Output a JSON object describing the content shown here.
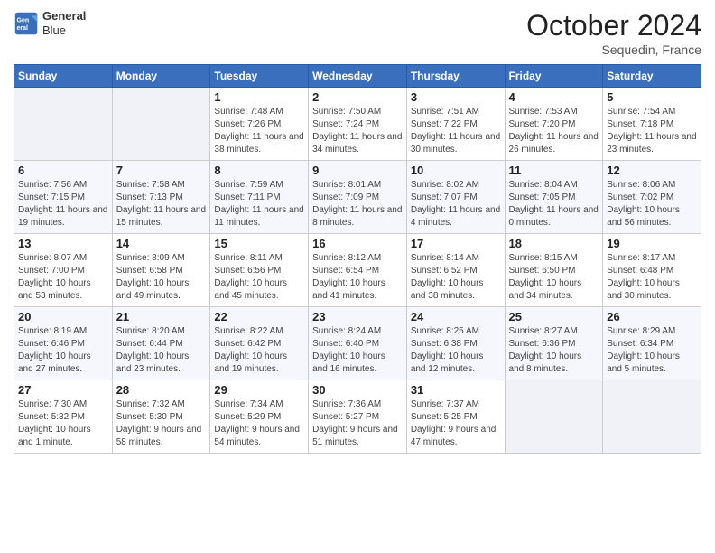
{
  "logo": {
    "line1": "General",
    "line2": "Blue"
  },
  "header": {
    "month": "October 2024",
    "location": "Sequedin, France"
  },
  "weekdays": [
    "Sunday",
    "Monday",
    "Tuesday",
    "Wednesday",
    "Thursday",
    "Friday",
    "Saturday"
  ],
  "weeks": [
    [
      {
        "day": "",
        "sunrise": "",
        "sunset": "",
        "daylight": ""
      },
      {
        "day": "",
        "sunrise": "",
        "sunset": "",
        "daylight": ""
      },
      {
        "day": "1",
        "sunrise": "Sunrise: 7:48 AM",
        "sunset": "Sunset: 7:26 PM",
        "daylight": "Daylight: 11 hours and 38 minutes."
      },
      {
        "day": "2",
        "sunrise": "Sunrise: 7:50 AM",
        "sunset": "Sunset: 7:24 PM",
        "daylight": "Daylight: 11 hours and 34 minutes."
      },
      {
        "day": "3",
        "sunrise": "Sunrise: 7:51 AM",
        "sunset": "Sunset: 7:22 PM",
        "daylight": "Daylight: 11 hours and 30 minutes."
      },
      {
        "day": "4",
        "sunrise": "Sunrise: 7:53 AM",
        "sunset": "Sunset: 7:20 PM",
        "daylight": "Daylight: 11 hours and 26 minutes."
      },
      {
        "day": "5",
        "sunrise": "Sunrise: 7:54 AM",
        "sunset": "Sunset: 7:18 PM",
        "daylight": "Daylight: 11 hours and 23 minutes."
      }
    ],
    [
      {
        "day": "6",
        "sunrise": "Sunrise: 7:56 AM",
        "sunset": "Sunset: 7:15 PM",
        "daylight": "Daylight: 11 hours and 19 minutes."
      },
      {
        "day": "7",
        "sunrise": "Sunrise: 7:58 AM",
        "sunset": "Sunset: 7:13 PM",
        "daylight": "Daylight: 11 hours and 15 minutes."
      },
      {
        "day": "8",
        "sunrise": "Sunrise: 7:59 AM",
        "sunset": "Sunset: 7:11 PM",
        "daylight": "Daylight: 11 hours and 11 minutes."
      },
      {
        "day": "9",
        "sunrise": "Sunrise: 8:01 AM",
        "sunset": "Sunset: 7:09 PM",
        "daylight": "Daylight: 11 hours and 8 minutes."
      },
      {
        "day": "10",
        "sunrise": "Sunrise: 8:02 AM",
        "sunset": "Sunset: 7:07 PM",
        "daylight": "Daylight: 11 hours and 4 minutes."
      },
      {
        "day": "11",
        "sunrise": "Sunrise: 8:04 AM",
        "sunset": "Sunset: 7:05 PM",
        "daylight": "Daylight: 11 hours and 0 minutes."
      },
      {
        "day": "12",
        "sunrise": "Sunrise: 8:06 AM",
        "sunset": "Sunset: 7:02 PM",
        "daylight": "Daylight: 10 hours and 56 minutes."
      }
    ],
    [
      {
        "day": "13",
        "sunrise": "Sunrise: 8:07 AM",
        "sunset": "Sunset: 7:00 PM",
        "daylight": "Daylight: 10 hours and 53 minutes."
      },
      {
        "day": "14",
        "sunrise": "Sunrise: 8:09 AM",
        "sunset": "Sunset: 6:58 PM",
        "daylight": "Daylight: 10 hours and 49 minutes."
      },
      {
        "day": "15",
        "sunrise": "Sunrise: 8:11 AM",
        "sunset": "Sunset: 6:56 PM",
        "daylight": "Daylight: 10 hours and 45 minutes."
      },
      {
        "day": "16",
        "sunrise": "Sunrise: 8:12 AM",
        "sunset": "Sunset: 6:54 PM",
        "daylight": "Daylight: 10 hours and 41 minutes."
      },
      {
        "day": "17",
        "sunrise": "Sunrise: 8:14 AM",
        "sunset": "Sunset: 6:52 PM",
        "daylight": "Daylight: 10 hours and 38 minutes."
      },
      {
        "day": "18",
        "sunrise": "Sunrise: 8:15 AM",
        "sunset": "Sunset: 6:50 PM",
        "daylight": "Daylight: 10 hours and 34 minutes."
      },
      {
        "day": "19",
        "sunrise": "Sunrise: 8:17 AM",
        "sunset": "Sunset: 6:48 PM",
        "daylight": "Daylight: 10 hours and 30 minutes."
      }
    ],
    [
      {
        "day": "20",
        "sunrise": "Sunrise: 8:19 AM",
        "sunset": "Sunset: 6:46 PM",
        "daylight": "Daylight: 10 hours and 27 minutes."
      },
      {
        "day": "21",
        "sunrise": "Sunrise: 8:20 AM",
        "sunset": "Sunset: 6:44 PM",
        "daylight": "Daylight: 10 hours and 23 minutes."
      },
      {
        "day": "22",
        "sunrise": "Sunrise: 8:22 AM",
        "sunset": "Sunset: 6:42 PM",
        "daylight": "Daylight: 10 hours and 19 minutes."
      },
      {
        "day": "23",
        "sunrise": "Sunrise: 8:24 AM",
        "sunset": "Sunset: 6:40 PM",
        "daylight": "Daylight: 10 hours and 16 minutes."
      },
      {
        "day": "24",
        "sunrise": "Sunrise: 8:25 AM",
        "sunset": "Sunset: 6:38 PM",
        "daylight": "Daylight: 10 hours and 12 minutes."
      },
      {
        "day": "25",
        "sunrise": "Sunrise: 8:27 AM",
        "sunset": "Sunset: 6:36 PM",
        "daylight": "Daylight: 10 hours and 8 minutes."
      },
      {
        "day": "26",
        "sunrise": "Sunrise: 8:29 AM",
        "sunset": "Sunset: 6:34 PM",
        "daylight": "Daylight: 10 hours and 5 minutes."
      }
    ],
    [
      {
        "day": "27",
        "sunrise": "Sunrise: 7:30 AM",
        "sunset": "Sunset: 5:32 PM",
        "daylight": "Daylight: 10 hours and 1 minute."
      },
      {
        "day": "28",
        "sunrise": "Sunrise: 7:32 AM",
        "sunset": "Sunset: 5:30 PM",
        "daylight": "Daylight: 9 hours and 58 minutes."
      },
      {
        "day": "29",
        "sunrise": "Sunrise: 7:34 AM",
        "sunset": "Sunset: 5:29 PM",
        "daylight": "Daylight: 9 hours and 54 minutes."
      },
      {
        "day": "30",
        "sunrise": "Sunrise: 7:36 AM",
        "sunset": "Sunset: 5:27 PM",
        "daylight": "Daylight: 9 hours and 51 minutes."
      },
      {
        "day": "31",
        "sunrise": "Sunrise: 7:37 AM",
        "sunset": "Sunset: 5:25 PM",
        "daylight": "Daylight: 9 hours and 47 minutes."
      },
      {
        "day": "",
        "sunrise": "",
        "sunset": "",
        "daylight": ""
      },
      {
        "day": "",
        "sunrise": "",
        "sunset": "",
        "daylight": ""
      }
    ]
  ]
}
